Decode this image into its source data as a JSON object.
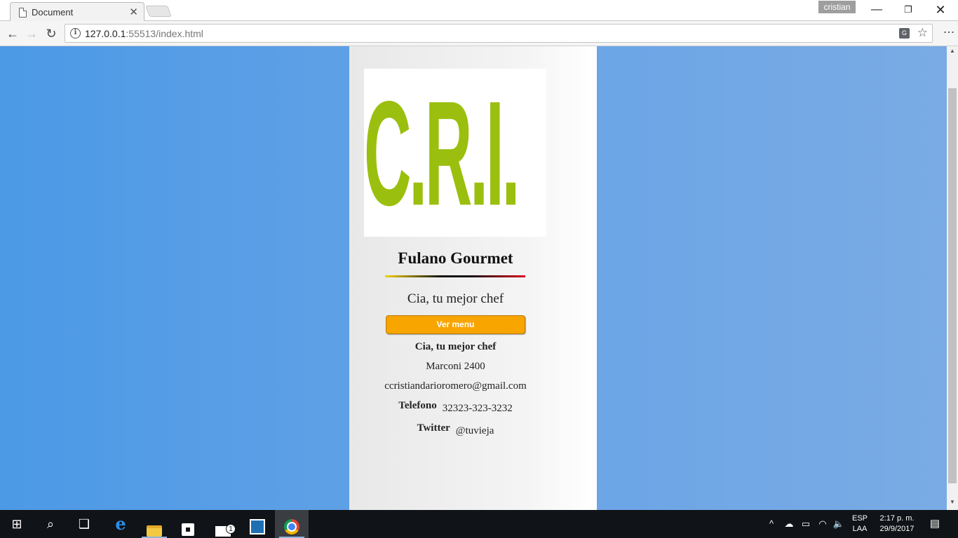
{
  "browser": {
    "tab_title": "Document",
    "tab_close": "✕",
    "profile_name": "cristian",
    "window_controls": {
      "minimize": "—",
      "maximize": "❐",
      "close": "✕"
    },
    "url_host": "127.0.0.1",
    "url_rest": ":55513/index.html",
    "nav": {
      "back": "←",
      "forward": "→",
      "reload": "↻"
    },
    "info_glyph": "i",
    "translate_glyph": "G",
    "star_glyph": "☆",
    "menu_glyph": "⋮"
  },
  "page": {
    "logo_text": "C.R.I.",
    "title": "Fulano Gourmet",
    "tagline": "Cia, tu mejor chef",
    "menu_button": "Ver menu",
    "company": "Cia, tu mejor chef",
    "address": "Marconi 2400",
    "email": "ccristiandarioromero@gmail.com",
    "phone_label": "Telefono",
    "phone_value": "32323-323-3232",
    "twitter_label": "Twitter",
    "twitter_value": "@tuvieja"
  },
  "colors": {
    "logo_green": "#9bbf0e",
    "button_orange": "#f9a500",
    "page_blue": "#4c99e6"
  },
  "taskbar": {
    "start_glyph": "⊞",
    "search_glyph": "⌕",
    "taskview_glyph": "❑",
    "edge_glyph": "e",
    "mail_badge": "1",
    "tray_chevron": "^",
    "tray_cloud": "☁",
    "tray_battery": "▭",
    "tray_wifi": "◠",
    "tray_volume": "🔈",
    "lang_top": "ESP",
    "lang_bottom": "LAA",
    "time": "2:17 p. m.",
    "date": "29/9/2017",
    "notif_glyph": "▤"
  }
}
